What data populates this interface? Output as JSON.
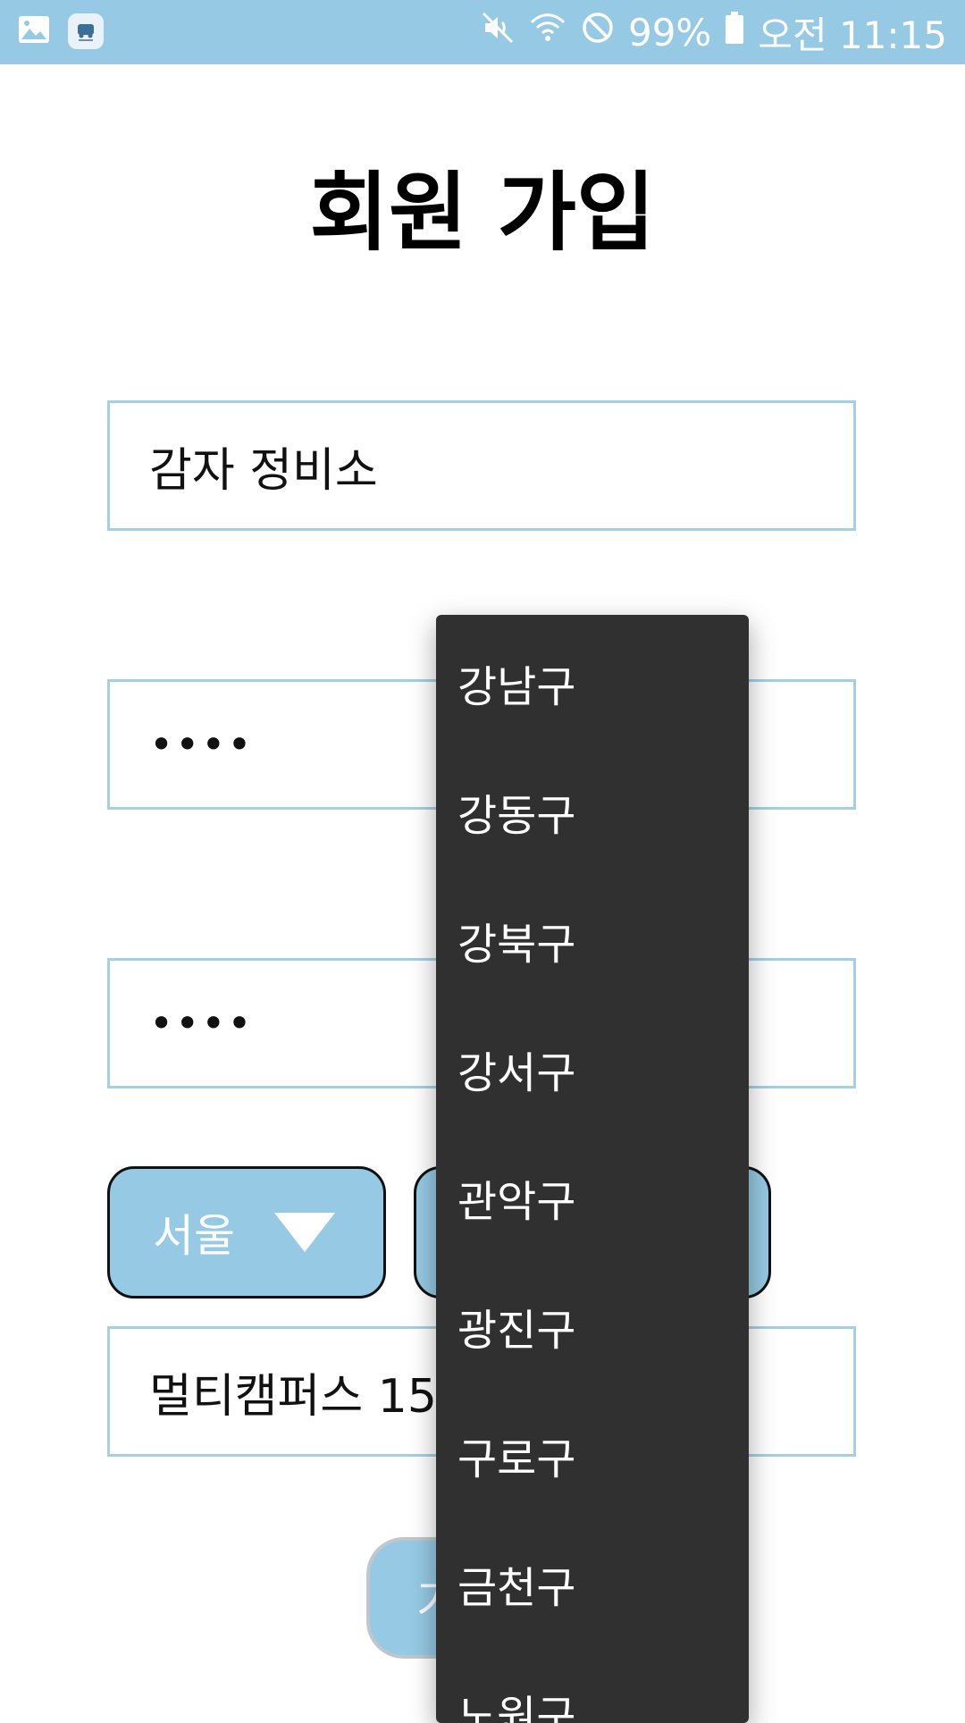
{
  "status_bar": {
    "notification_icons": [
      "image-icon",
      "app-icon"
    ],
    "system_icons": [
      "mute-icon",
      "wifi-icon",
      "blocked-icon",
      "battery-icon"
    ],
    "battery": "99%",
    "time": "오전 11:15"
  },
  "page": {
    "title": "회원 가입"
  },
  "form": {
    "name_value": "감자 정비소",
    "password_value": "••••",
    "password_confirm_value": "••••",
    "city_label": "서울",
    "address_value": "멀티캠퍼스 15",
    "submit_label": "가"
  },
  "district_dropdown": {
    "items": [
      "강남구",
      "강동구",
      "강북구",
      "강서구",
      "관악구",
      "광진구",
      "구로구",
      "금천구",
      "노원구"
    ]
  },
  "colors": {
    "accent": "#96cae4",
    "field_border": "#a5d0e2",
    "dropdown_bg": "#303030"
  }
}
